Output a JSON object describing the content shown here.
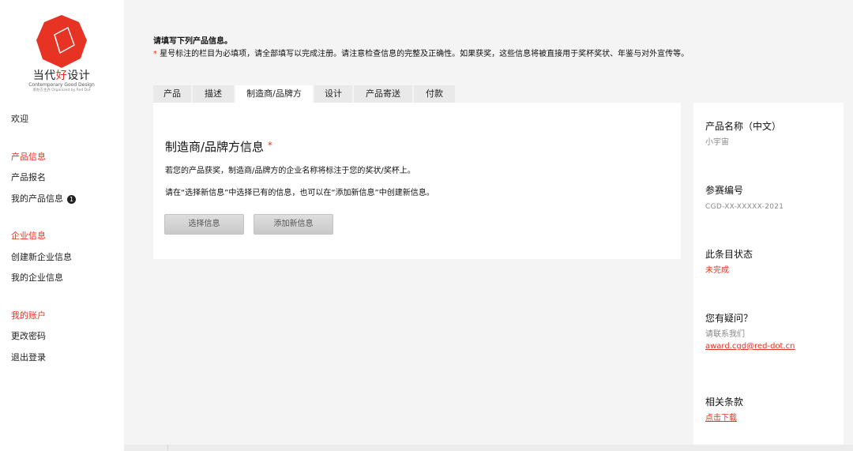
{
  "brand": {
    "title_pre": "当代",
    "title_hl": "好",
    "title_post": "设计",
    "subtitle": "Contemporary Good Design",
    "organizer": "承办方主办 Organized by Red Dot",
    "accent_color": "#e63323"
  },
  "sidebar": {
    "welcome": "欢迎",
    "sections": [
      {
        "heading": "产品信息",
        "items": [
          "产品报名",
          "我的产品信息"
        ]
      },
      {
        "heading": "企业信息",
        "items": [
          "创建新企业信息",
          "我的企业信息"
        ]
      },
      {
        "heading": "我的账户",
        "items": [
          "更改密码",
          "退出登录"
        ]
      }
    ],
    "badge": "1"
  },
  "intro": {
    "title": "请填写下列产品信息。",
    "asterisk": "*",
    "note": " 星号标注的栏目为必填项，请全部填写以完成注册。请注意检查信息的完整及正确性。如果获奖，这些信息将被直接用于奖杯奖状、年鉴与对外宣传等。"
  },
  "tabs": [
    "产品",
    "描述",
    "制造商/品牌方",
    "设计",
    "产品寄送",
    "付款"
  ],
  "active_tab": "制造商/品牌方",
  "panel": {
    "title": "制造商/品牌方信息",
    "asterisk": "*",
    "p1": "若您的产品获奖，制造商/品牌方的企业名称将标注于您的奖状/奖杯上。",
    "p2": "请在“选择新信息”中选择已有的信息，也可以在“添加新信息”中创建新信息。",
    "btn_select": "选择信息",
    "btn_add": "添加新信息"
  },
  "side_info": {
    "product_name_label": "产品名称（中文）",
    "product_name_value": "小宇宙",
    "entry_no_label": "参赛编号",
    "entry_no_value": "CGD-XX-XXXXX-2021",
    "status_label": "此条目状态",
    "status_value": "未完成",
    "question_label": "您有疑问？",
    "contact_label": "请联系我们",
    "contact_email": "award.cgd@red-dot.cn",
    "terms_label": "相关条款",
    "terms_link": "点击下载"
  }
}
